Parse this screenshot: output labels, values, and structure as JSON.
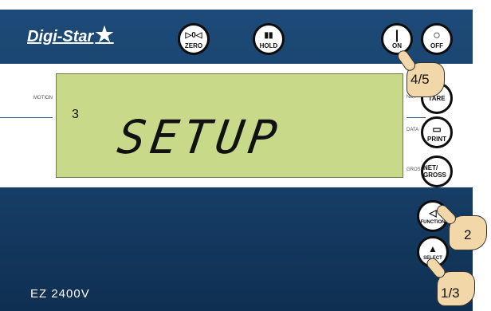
{
  "device": {
    "brand": "Digi-Star",
    "model": "EZ 2400V"
  },
  "top_buttons": {
    "zero": {
      "symbol": "▷0◁",
      "label": "ZERO"
    },
    "hold": {
      "symbol": "▮▮",
      "label": "HOLD"
    },
    "on": {
      "symbol": "|",
      "label": "ON"
    },
    "off": {
      "symbol": "○",
      "label": "OFF"
    }
  },
  "side_buttons": {
    "tare": {
      "label": "TARE"
    },
    "print": {
      "label": "PRINT"
    },
    "netgross": {
      "label": "NET/ GROSS"
    },
    "function": {
      "symbol": "◁",
      "label": "FUNCTION"
    },
    "select": {
      "symbol": "▲",
      "label": "SELECT"
    }
  },
  "labels": {
    "motion": "MOTION",
    "net": "NET",
    "data": "DATA",
    "gross": "GROSS"
  },
  "display": {
    "text": "SETUP",
    "step": "3"
  },
  "steps": {
    "on": "4/5",
    "function": "2",
    "select": "1/3"
  },
  "colors": {
    "panel": "#1a3f66",
    "lcd": "#c8d98a"
  }
}
